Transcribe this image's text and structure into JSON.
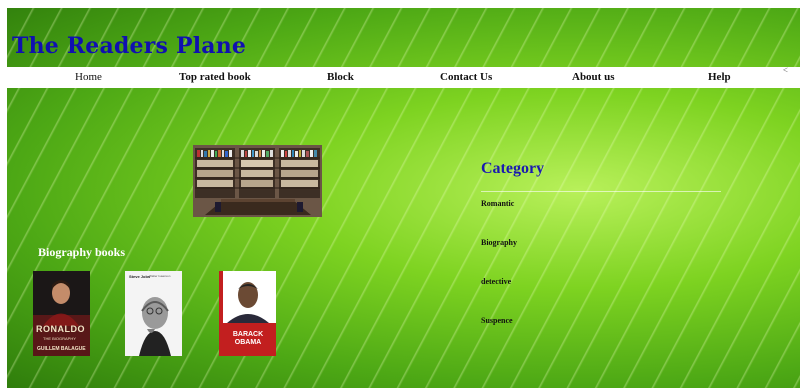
{
  "site": {
    "title": "The Readers Plane"
  },
  "nav": {
    "items": [
      {
        "label": "Home"
      },
      {
        "label": "Top rated book"
      },
      {
        "label": "Block"
      },
      {
        "label": "Contact Us"
      },
      {
        "label": "About us"
      },
      {
        "label": "Help"
      }
    ],
    "caret": "<"
  },
  "biography": {
    "heading": "Biography books",
    "books": [
      {
        "cover_title": "RONALDO",
        "cover_author": "GUILLEM BALAGUE",
        "cover_sub": "THE BIOGRAPHY"
      },
      {
        "cover_title": "Steve Jobs",
        "cover_author": "Walter Isaacson"
      },
      {
        "cover_title": "BARACK OBAMA"
      }
    ]
  },
  "category": {
    "heading": "Category",
    "items": [
      "Romantic",
      "Biography",
      "detective",
      "Suspence"
    ]
  },
  "colors": {
    "title": "#1010b0",
    "category": "#1a1ab0",
    "background": "#7ed321"
  }
}
